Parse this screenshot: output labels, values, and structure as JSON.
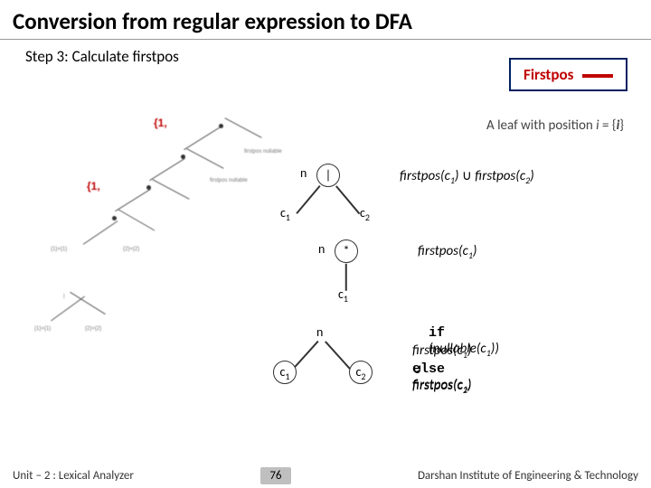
{
  "title": "Conversion from regular expression to DFA",
  "subtitle": "Step 3: Calculate firstpos",
  "legend": {
    "label": "Firstpos"
  },
  "leaf_rule_html": "A leaf with position <i>i</i> = {<b><i>i</i></b>}",
  "left_blur": {
    "set_top": "{1,",
    "set_mid": "{1,"
  },
  "labels": {
    "n": "n",
    "c1_html": "c<sub class='sub'>1</sub>",
    "c2_html": "c<sub class='sub'>2</sub>",
    "pipe": "|",
    "star": "*"
  },
  "rules": {
    "union_html": "<span class='fn'>firstpos</span>(c<sub class='sub'>1</sub>) <span class='cup'>∪</span> <span class='fn'>firstpos</span>(c<sub class='sub'>2</sub>)",
    "star_html": "<span class='fn'>firstpos</span>(c<sub class='sub'>1</sub>)",
    "concat_if_html": "<span class='kw'>if</span>&nbsp; (nullable(c<sub class='sub'>1</sub>))",
    "concat_then_html": "<span class='fn'>firstpos</span>(c<sub class='sub'>1</sub>) <span class='cup'>∪</span> <span class='fn'>firstpos</span>(c<sub class='sub'>2</sub>)",
    "concat_else_html": "<span class='kw'>else</span>&nbsp; <span class='fn'>firstpos</span>(c<sub class='sub'>1</sub>)"
  },
  "footer": {
    "left": "Unit – 2  : Lexical Analyzer",
    "page": "76",
    "right": "Darshan Institute of Engineering & Technology"
  }
}
